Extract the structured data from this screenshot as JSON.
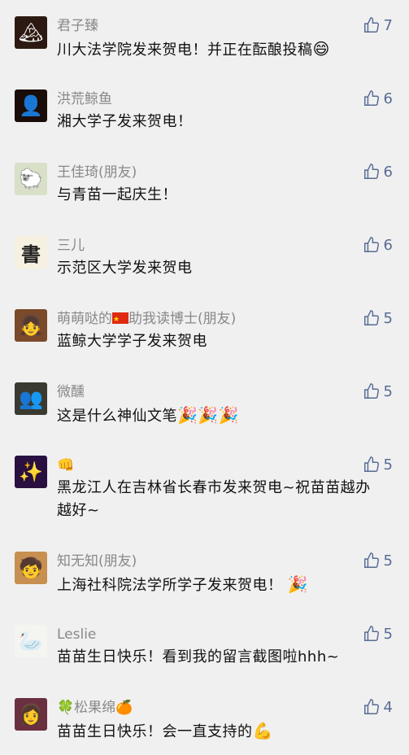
{
  "comments": [
    {
      "nickname": "君子臻",
      "text": "川大法学院发来贺电！并正在酝酿投稿",
      "emoji": "😄",
      "likes": "7",
      "avatar_bg": "#2c1a12",
      "avatar_glyph": "🏔"
    },
    {
      "nickname": "洪荒鲸鱼",
      "text": "湘大学子发来贺电！",
      "emoji": "",
      "likes": "6",
      "avatar_bg": "#1a0c08",
      "avatar_glyph": "👤"
    },
    {
      "nickname": "王佳琦(朋友)",
      "text": "与青苗一起庆生！",
      "emoji": "",
      "likes": "6",
      "avatar_bg": "#d8e0c8",
      "avatar_glyph": "🐑"
    },
    {
      "nickname": "三儿",
      "text": "示范区大学发来贺电",
      "emoji": "",
      "likes": "6",
      "avatar_bg": "#f6f0e0",
      "avatar_glyph": "書"
    },
    {
      "nickname_pre": "萌萌哒的",
      "nickname_post": "助我读博士(朋友)",
      "text": "蓝鲸大学学子发来贺电",
      "emoji": "",
      "likes": "5",
      "avatar_bg": "#7a4a2a",
      "avatar_glyph": "👧"
    },
    {
      "nickname": "微醺",
      "text": "这是什么神仙文笔",
      "emoji": "🎉🎉🎉",
      "likes": "5",
      "avatar_bg": "#3a3a30",
      "avatar_glyph": "👥"
    },
    {
      "nickname": "👊",
      "text": "黑龙江人在吉林省长春市发来贺电~祝苗苗越办越好~",
      "emoji": "",
      "likes": "5",
      "avatar_bg": "#2a1040",
      "avatar_glyph": "✨"
    },
    {
      "nickname": "知无知(朋友)",
      "text": "上海社科院法学所学子发来贺电！",
      "emoji": "🎉",
      "likes": "5",
      "avatar_bg": "#c89050",
      "avatar_glyph": "🧒"
    },
    {
      "nickname": "Leslie",
      "text": "苗苗生日快乐！看到我的留言截图啦hhh~",
      "emoji": "",
      "likes": "5",
      "avatar_bg": "#f4f4f0",
      "avatar_glyph": "🦢"
    },
    {
      "nickname_pre": "🍀",
      "nickname_mid": "松果绵",
      "nickname_post": "🍊",
      "text": "苗苗生日快乐！会一直支持的",
      "emoji": "💪",
      "likes": "4",
      "avatar_bg": "#6a3040",
      "avatar_glyph": "👩"
    }
  ]
}
